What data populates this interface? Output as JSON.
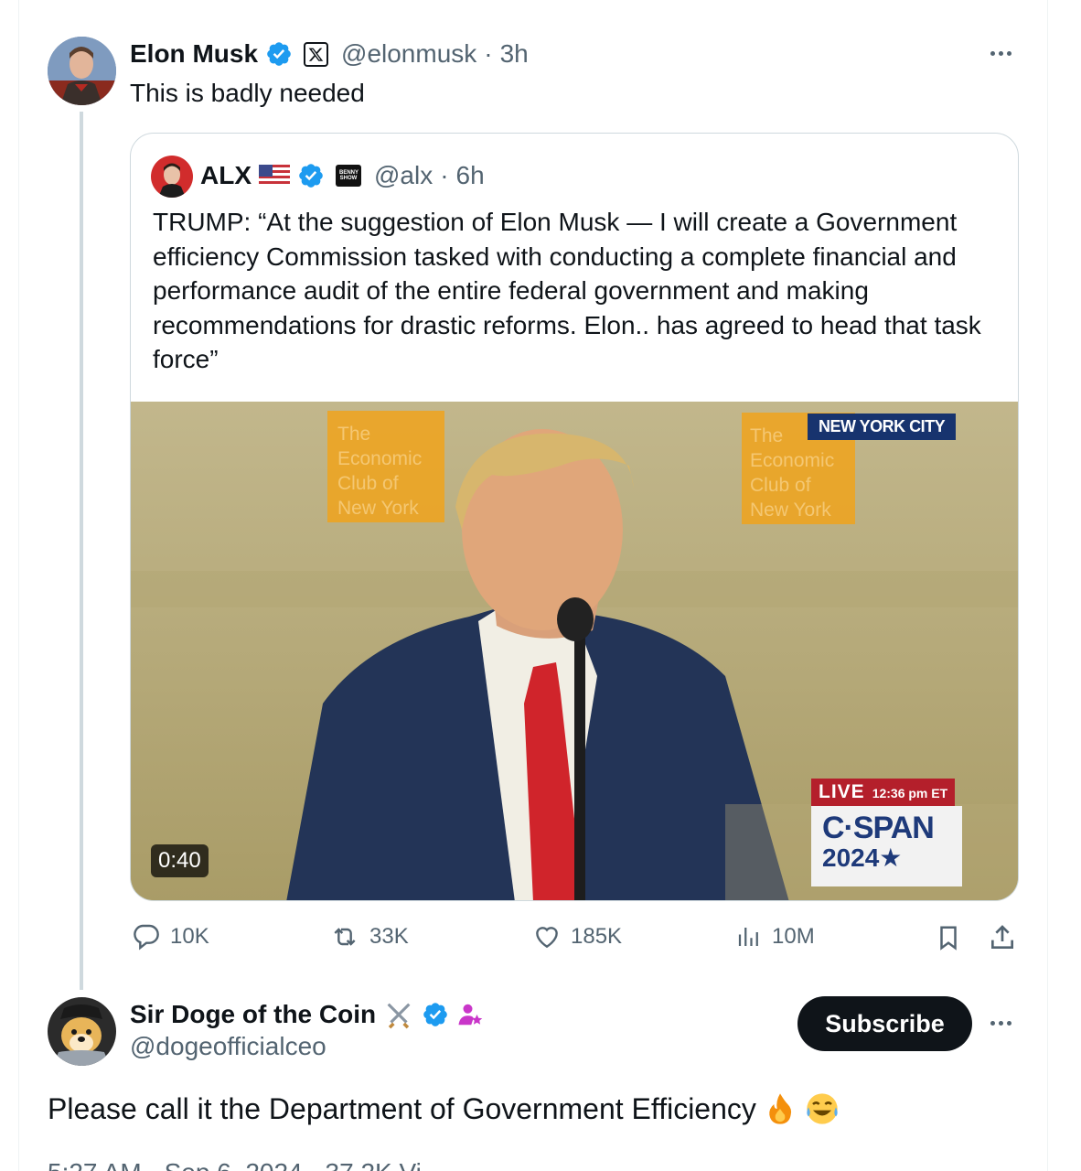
{
  "main_post": {
    "author_name": "Elon Musk",
    "handle": "@elonmusk",
    "separator": "·",
    "time": "3h",
    "text": "This is badly needed"
  },
  "quoted_post": {
    "author_name": "ALX",
    "badge_text": "BENNY SHOW",
    "handle": "@alx",
    "separator": "·",
    "time": "6h",
    "text": "TRUMP: “At the suggestion of Elon Musk — I will create a Government efficiency Commission tasked with conducting a complete financial and performance audit of the entire federal government and making recommendations for drastic reforms. Elon.. has agreed to head that task force”",
    "video": {
      "duration": "0:40",
      "banner_left": [
        "The",
        "Economic",
        "Club of",
        "New York"
      ],
      "banner_right": [
        "The",
        "Economic",
        "Club of",
        "New York"
      ],
      "location_tag": "NEW YORK CITY",
      "live_label": "LIVE",
      "live_time": "12:36 pm ET",
      "network": "C·SPAN",
      "network_year": "2024★"
    }
  },
  "actions": {
    "replies": "10K",
    "reposts": "33K",
    "likes": "185K",
    "views": "10M"
  },
  "reply_post": {
    "author_name": "Sir Doge of the Coin",
    "handle": "@dogeofficialceo",
    "subscribe_label": "Subscribe",
    "text": "Please call it the Department of Government Efficiency",
    "meta": "5:27 AM · Sep 6, 2024 · 37.2K Vi"
  },
  "colors": {
    "verified": "#1d9bf0",
    "text": "#0f1419",
    "muted": "#536471",
    "border": "#cfd9de",
    "banner_orange": "#f0a31c"
  }
}
